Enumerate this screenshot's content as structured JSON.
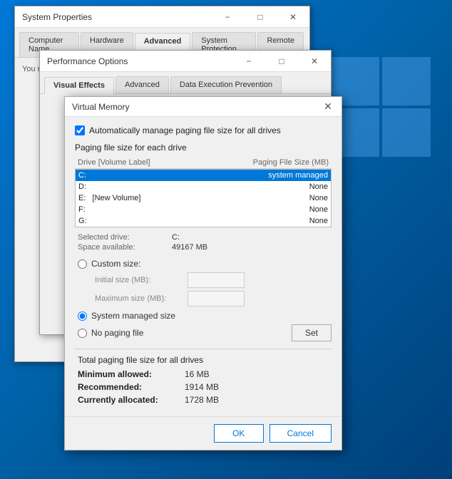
{
  "desktop": {
    "background": "#0078d7"
  },
  "system_props": {
    "title": "System Properties",
    "tabs": [
      {
        "label": "Computer Name",
        "active": false
      },
      {
        "label": "Hardware",
        "active": false
      },
      {
        "label": "Advanced",
        "active": true
      },
      {
        "label": "System Protection",
        "active": false
      },
      {
        "label": "Remote",
        "active": false
      }
    ]
  },
  "perf_options": {
    "title": "Performance Options",
    "tabs": [
      {
        "label": "Visual Effects",
        "active": true
      },
      {
        "label": "Advanced",
        "active": false
      },
      {
        "label": "Data Execution Prevention",
        "active": false
      }
    ]
  },
  "virtual_memory": {
    "title": "Virtual Memory",
    "close_symbol": "✕",
    "auto_manage_label": "Automatically manage paging file size for all drives",
    "paging_section_label": "Paging file size for each drive",
    "drive_table_header_drive": "Drive  [Volume Label]",
    "drive_table_header_size": "Paging File Size (MB)",
    "drives": [
      {
        "drive": "C:",
        "label": "",
        "size": "system managed",
        "selected": true
      },
      {
        "drive": "D:",
        "label": "",
        "size": "None",
        "selected": false
      },
      {
        "drive": "E:",
        "label": "[New Volume]",
        "size": "None",
        "selected": false
      },
      {
        "drive": "F:",
        "label": "",
        "size": "None",
        "selected": false
      },
      {
        "drive": "G:",
        "label": "",
        "size": "None",
        "selected": false
      }
    ],
    "selected_drive_label": "Selected drive:",
    "selected_drive_value": "C:",
    "space_available_label": "Space available:",
    "space_available_value": "49167 MB",
    "custom_size_label": "Custom size:",
    "initial_size_label": "Initial size (MB):",
    "maximum_size_label": "Maximum size (MB):",
    "system_managed_label": "System managed size",
    "no_paging_label": "No paging file",
    "set_button": "Set",
    "total_section_label": "Total paging file size for all drives",
    "minimum_allowed_label": "Minimum allowed:",
    "minimum_allowed_value": "16 MB",
    "recommended_label": "Recommended:",
    "recommended_value": "1914 MB",
    "currently_allocated_label": "Currently allocated:",
    "currently_allocated_value": "1728 MB",
    "ok_button": "OK",
    "cancel_button": "Cancel"
  }
}
